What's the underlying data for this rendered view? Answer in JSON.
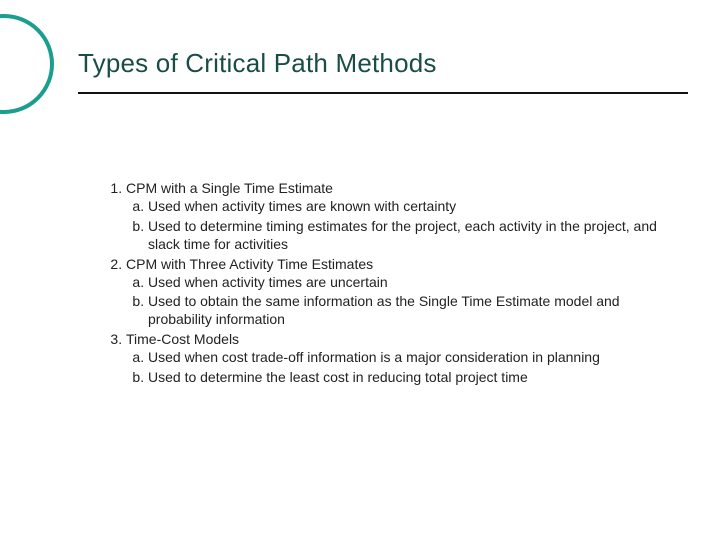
{
  "title": "Types of Critical Path Methods",
  "items": [
    {
      "label": "CPM with a Single Time Estimate",
      "sub": [
        "Used when activity times are known with certainty",
        "Used to determine timing estimates for the project, each activity in the project, and slack time for activities"
      ]
    },
    {
      "label": "CPM with Three Activity Time Estimates",
      "sub": [
        "Used when activity times are uncertain",
        "Used to obtain the same information as the Single Time Estimate model and probability information"
      ]
    },
    {
      "label": "Time-Cost Models",
      "sub": [
        "Used when cost trade-off information is a major consideration in planning",
        "Used to determine the least cost in reducing total project time"
      ]
    }
  ]
}
